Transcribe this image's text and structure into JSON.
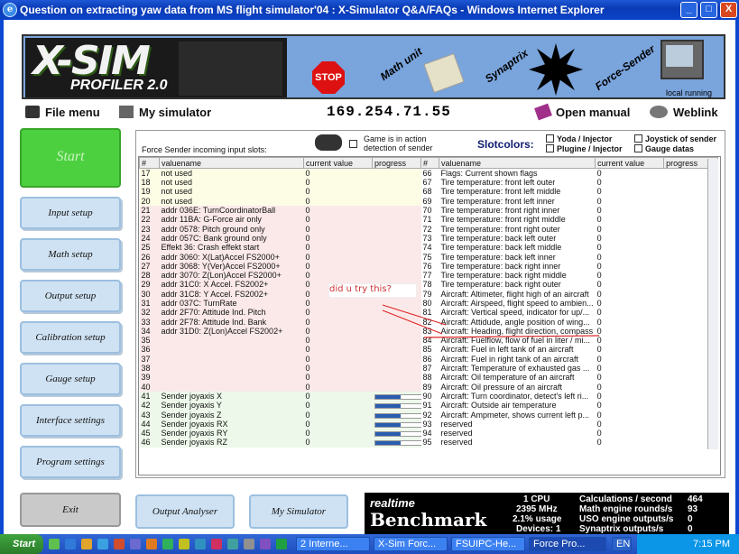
{
  "window": {
    "title": "Question on extracting yaw data from MS flight simulator'04 : X-Simulator Q&A/FAQs - Windows Internet Explorer",
    "btn_min": "_",
    "btn_max": "□",
    "btn_close": "X"
  },
  "banner": {
    "logo": "X-SIM",
    "profiler": "PROFILER 2.0",
    "stop": "STOP",
    "math": "Math unit",
    "synaptrix": "Synaptrix",
    "force": "Force-Sender",
    "local": "local running"
  },
  "menu": {
    "file": "File menu",
    "sim": "My simulator",
    "ip": "169.254.71.55",
    "open": "Open manual",
    "web": "Weblink"
  },
  "side": {
    "start": "Start",
    "input": "Input setup",
    "math": "Math setup",
    "output": "Output setup",
    "calib": "Calibration setup",
    "gauge": "Gauge setup",
    "iface": "Interface settings",
    "prog": "Program settings",
    "exit": "Exit",
    "outana": "Output Analyser",
    "mysim": "My Simulator"
  },
  "panel": {
    "label": "Force Sender incoming input slots:",
    "game1": "Game is in action",
    "game2": "detection of sender",
    "slot": "Slotcolors:",
    "yoda": "Yoda / Injector",
    "plug": "Plugine / Injector",
    "joy": "Joystick of sender",
    "gauge": "Gauge datas"
  },
  "headers": {
    "num": "#",
    "name": "valuename",
    "cur": "current value",
    "prog": "progress"
  },
  "left_rows": [
    {
      "n": "17",
      "name": "not used",
      "v": "0",
      "c": "y"
    },
    {
      "n": "18",
      "name": "not used",
      "v": "0",
      "c": "y"
    },
    {
      "n": "19",
      "name": "not used",
      "v": "0",
      "c": "y"
    },
    {
      "n": "20",
      "name": "not used",
      "v": "0",
      "c": "y"
    },
    {
      "n": "21",
      "name": "addr 036E: TurnCoordinatorBall",
      "v": "0",
      "c": "p"
    },
    {
      "n": "22",
      "name": "addr 11BA: G-Force air only",
      "v": "0",
      "c": "p"
    },
    {
      "n": "23",
      "name": "addr 0578: Pitch ground only",
      "v": "0",
      "c": "p"
    },
    {
      "n": "24",
      "name": "addr 057C: Bank ground only",
      "v": "0",
      "c": "p"
    },
    {
      "n": "25",
      "name": "Effekt 36: Crash effekt start",
      "v": "0",
      "c": "p"
    },
    {
      "n": "26",
      "name": "addr 3060: X(Lat)Accel FS2000+",
      "v": "0",
      "c": "p"
    },
    {
      "n": "27",
      "name": "addr 3068: Y(Ver)Accel FS2000+",
      "v": "0",
      "c": "p"
    },
    {
      "n": "28",
      "name": "addr 3070: Z(Lon)Accel FS2000+",
      "v": "0",
      "c": "p"
    },
    {
      "n": "29",
      "name": "addr 31C0: X Accel. FS2002+",
      "v": "0",
      "c": "p"
    },
    {
      "n": "30",
      "name": "addr 31C8: Y Accel. FS2002+",
      "v": "0",
      "c": "p"
    },
    {
      "n": "31",
      "name": "addr 037C: TurnRate",
      "v": "0",
      "c": "p"
    },
    {
      "n": "32",
      "name": "addr 2F70: Attitude Ind. Pitch",
      "v": "0",
      "c": "p"
    },
    {
      "n": "33",
      "name": "addr 2F78: Attitude Ind. Bank",
      "v": "0",
      "c": "p"
    },
    {
      "n": "34",
      "name": "addr 31D0: Z(Lon)Accel FS2002+",
      "v": "0",
      "c": "p"
    },
    {
      "n": "35",
      "name": "",
      "v": "0",
      "c": "p"
    },
    {
      "n": "36",
      "name": "",
      "v": "0",
      "c": "p"
    },
    {
      "n": "37",
      "name": "",
      "v": "0",
      "c": "p"
    },
    {
      "n": "38",
      "name": "",
      "v": "0",
      "c": "p"
    },
    {
      "n": "39",
      "name": "",
      "v": "0",
      "c": "p"
    },
    {
      "n": "40",
      "name": "",
      "v": "0",
      "c": "p"
    },
    {
      "n": "41",
      "name": "Sender joyaxis X",
      "v": "0",
      "c": "g",
      "p": 0.55
    },
    {
      "n": "42",
      "name": "Sender joyaxis Y",
      "v": "0",
      "c": "g",
      "p": 0.55
    },
    {
      "n": "43",
      "name": "Sender joyaxis Z",
      "v": "0",
      "c": "g",
      "p": 0.55
    },
    {
      "n": "44",
      "name": "Sender joyaxis RX",
      "v": "0",
      "c": "g",
      "p": 0.55
    },
    {
      "n": "45",
      "name": "Sender joyaxis RY",
      "v": "0",
      "c": "g",
      "p": 0.55
    },
    {
      "n": "46",
      "name": "Sender joyaxis RZ",
      "v": "0",
      "c": "g",
      "p": 0.55
    }
  ],
  "right_rows": [
    {
      "n": "66",
      "name": "Flags: Current shown flags",
      "v": "0"
    },
    {
      "n": "67",
      "name": "Tire temperature: front left outer",
      "v": "0"
    },
    {
      "n": "68",
      "name": "Tire temperature: front left middle",
      "v": "0"
    },
    {
      "n": "69",
      "name": "Tire temperature: front left inner",
      "v": "0"
    },
    {
      "n": "70",
      "name": "Tire temperature: front right inner",
      "v": "0"
    },
    {
      "n": "71",
      "name": "Tire temperature: front right middle",
      "v": "0"
    },
    {
      "n": "72",
      "name": "Tire temperature: front right outer",
      "v": "0"
    },
    {
      "n": "73",
      "name": "Tire temperature: back left outer",
      "v": "0"
    },
    {
      "n": "74",
      "name": "Tire temperature: back left middle",
      "v": "0"
    },
    {
      "n": "75",
      "name": "Tire temperature: back left inner",
      "v": "0"
    },
    {
      "n": "76",
      "name": "Tire temperature: back right inner",
      "v": "0"
    },
    {
      "n": "77",
      "name": "Tire temperature: back right middle",
      "v": "0"
    },
    {
      "n": "78",
      "name": "Tire temperature: back right outer",
      "v": "0"
    },
    {
      "n": "79",
      "name": "Aircraft: Altimeter, flight high of an aircraft",
      "v": "0"
    },
    {
      "n": "80",
      "name": "Aircraft: Airspeed, flight speed to ambien...",
      "v": "0"
    },
    {
      "n": "81",
      "name": "Aircraft: Vertical speed, indicator for up/...",
      "v": "0"
    },
    {
      "n": "82",
      "name": "Aircraft: Attidude, angle position of wing...",
      "v": "0"
    },
    {
      "n": "83",
      "name": "Aircraft: Heading, flight direction, compass",
      "v": "0"
    },
    {
      "n": "84",
      "name": "Aircraft: Fuelflow, flow of fuel in liter / mi...",
      "v": "0"
    },
    {
      "n": "85",
      "name": "Aircraft: Fuel in left tank of an aircraft",
      "v": "0"
    },
    {
      "n": "86",
      "name": "Aircraft: Fuel in right tank of an aircraft",
      "v": "0"
    },
    {
      "n": "87",
      "name": "Aircraft: Temperature of exhausted gas ...",
      "v": "0"
    },
    {
      "n": "88",
      "name": "Aircraft: Oil temperature of an aircraft",
      "v": "0"
    },
    {
      "n": "89",
      "name": "Aircraft: Oil pressure of an aircraft",
      "v": "0"
    },
    {
      "n": "90",
      "name": "Aircraft: Turn coordinator, detect's left ri...",
      "v": "0"
    },
    {
      "n": "91",
      "name": "Aircraft: Outside air temperature",
      "v": "0"
    },
    {
      "n": "92",
      "name": "Aircraft: Ampmeter, shows current left p...",
      "v": "0"
    },
    {
      "n": "93",
      "name": "reserved",
      "v": "0"
    },
    {
      "n": "94",
      "name": "reserved",
      "v": "0"
    },
    {
      "n": "95",
      "name": "reserved",
      "v": "0"
    }
  ],
  "annotation": "did u try this?",
  "bench": {
    "rt": "realtime",
    "bm": "Benchmark",
    "cpu": "1 CPU",
    "mhz": "2395 MHz",
    "usage": "2.1% usage",
    "dev": "Devices: 1",
    "calc_l": "Calculations / second",
    "calc_v": "464",
    "math_l": "Math engine rounds/s",
    "math_v": "93",
    "uso_l": "USO engine outputs/s",
    "uso_v": "0",
    "syn_l": "Synaptrix outputs/s",
    "syn_v": "0"
  },
  "taskbar": {
    "start": "Start",
    "t1": "2 Interne...",
    "t2": "X-Sim Forc...",
    "t3": "FSUIPC-He...",
    "t4": "Force Pro...",
    "lang": "EN",
    "time": "7:15 PM"
  }
}
